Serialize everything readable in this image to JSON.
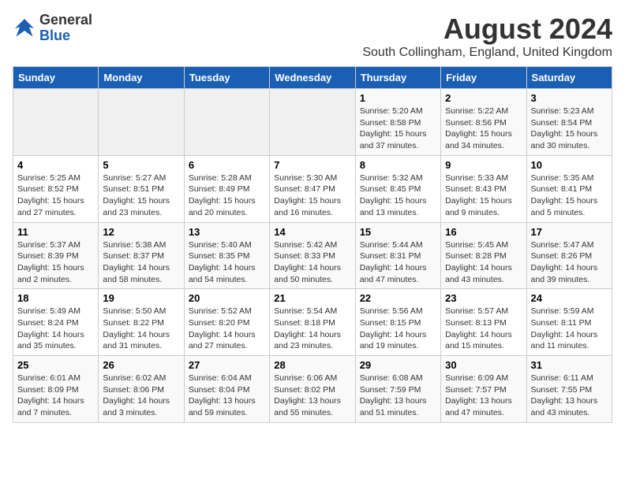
{
  "header": {
    "logo_line1": "General",
    "logo_line2": "Blue",
    "month_year": "August 2024",
    "location": "South Collingham, England, United Kingdom"
  },
  "weekdays": [
    "Sunday",
    "Monday",
    "Tuesday",
    "Wednesday",
    "Thursday",
    "Friday",
    "Saturday"
  ],
  "weeks": [
    [
      {
        "day": "",
        "info": ""
      },
      {
        "day": "",
        "info": ""
      },
      {
        "day": "",
        "info": ""
      },
      {
        "day": "",
        "info": ""
      },
      {
        "day": "1",
        "info": "Sunrise: 5:20 AM\nSunset: 8:58 PM\nDaylight: 15 hours\nand 37 minutes."
      },
      {
        "day": "2",
        "info": "Sunrise: 5:22 AM\nSunset: 8:56 PM\nDaylight: 15 hours\nand 34 minutes."
      },
      {
        "day": "3",
        "info": "Sunrise: 5:23 AM\nSunset: 8:54 PM\nDaylight: 15 hours\nand 30 minutes."
      }
    ],
    [
      {
        "day": "4",
        "info": "Sunrise: 5:25 AM\nSunset: 8:52 PM\nDaylight: 15 hours\nand 27 minutes."
      },
      {
        "day": "5",
        "info": "Sunrise: 5:27 AM\nSunset: 8:51 PM\nDaylight: 15 hours\nand 23 minutes."
      },
      {
        "day": "6",
        "info": "Sunrise: 5:28 AM\nSunset: 8:49 PM\nDaylight: 15 hours\nand 20 minutes."
      },
      {
        "day": "7",
        "info": "Sunrise: 5:30 AM\nSunset: 8:47 PM\nDaylight: 15 hours\nand 16 minutes."
      },
      {
        "day": "8",
        "info": "Sunrise: 5:32 AM\nSunset: 8:45 PM\nDaylight: 15 hours\nand 13 minutes."
      },
      {
        "day": "9",
        "info": "Sunrise: 5:33 AM\nSunset: 8:43 PM\nDaylight: 15 hours\nand 9 minutes."
      },
      {
        "day": "10",
        "info": "Sunrise: 5:35 AM\nSunset: 8:41 PM\nDaylight: 15 hours\nand 5 minutes."
      }
    ],
    [
      {
        "day": "11",
        "info": "Sunrise: 5:37 AM\nSunset: 8:39 PM\nDaylight: 15 hours\nand 2 minutes."
      },
      {
        "day": "12",
        "info": "Sunrise: 5:38 AM\nSunset: 8:37 PM\nDaylight: 14 hours\nand 58 minutes."
      },
      {
        "day": "13",
        "info": "Sunrise: 5:40 AM\nSunset: 8:35 PM\nDaylight: 14 hours\nand 54 minutes."
      },
      {
        "day": "14",
        "info": "Sunrise: 5:42 AM\nSunset: 8:33 PM\nDaylight: 14 hours\nand 50 minutes."
      },
      {
        "day": "15",
        "info": "Sunrise: 5:44 AM\nSunset: 8:31 PM\nDaylight: 14 hours\nand 47 minutes."
      },
      {
        "day": "16",
        "info": "Sunrise: 5:45 AM\nSunset: 8:28 PM\nDaylight: 14 hours\nand 43 minutes."
      },
      {
        "day": "17",
        "info": "Sunrise: 5:47 AM\nSunset: 8:26 PM\nDaylight: 14 hours\nand 39 minutes."
      }
    ],
    [
      {
        "day": "18",
        "info": "Sunrise: 5:49 AM\nSunset: 8:24 PM\nDaylight: 14 hours\nand 35 minutes."
      },
      {
        "day": "19",
        "info": "Sunrise: 5:50 AM\nSunset: 8:22 PM\nDaylight: 14 hours\nand 31 minutes."
      },
      {
        "day": "20",
        "info": "Sunrise: 5:52 AM\nSunset: 8:20 PM\nDaylight: 14 hours\nand 27 minutes."
      },
      {
        "day": "21",
        "info": "Sunrise: 5:54 AM\nSunset: 8:18 PM\nDaylight: 14 hours\nand 23 minutes."
      },
      {
        "day": "22",
        "info": "Sunrise: 5:56 AM\nSunset: 8:15 PM\nDaylight: 14 hours\nand 19 minutes."
      },
      {
        "day": "23",
        "info": "Sunrise: 5:57 AM\nSunset: 8:13 PM\nDaylight: 14 hours\nand 15 minutes."
      },
      {
        "day": "24",
        "info": "Sunrise: 5:59 AM\nSunset: 8:11 PM\nDaylight: 14 hours\nand 11 minutes."
      }
    ],
    [
      {
        "day": "25",
        "info": "Sunrise: 6:01 AM\nSunset: 8:09 PM\nDaylight: 14 hours\nand 7 minutes."
      },
      {
        "day": "26",
        "info": "Sunrise: 6:02 AM\nSunset: 8:06 PM\nDaylight: 14 hours\nand 3 minutes."
      },
      {
        "day": "27",
        "info": "Sunrise: 6:04 AM\nSunset: 8:04 PM\nDaylight: 13 hours\nand 59 minutes."
      },
      {
        "day": "28",
        "info": "Sunrise: 6:06 AM\nSunset: 8:02 PM\nDaylight: 13 hours\nand 55 minutes."
      },
      {
        "day": "29",
        "info": "Sunrise: 6:08 AM\nSunset: 7:59 PM\nDaylight: 13 hours\nand 51 minutes."
      },
      {
        "day": "30",
        "info": "Sunrise: 6:09 AM\nSunset: 7:57 PM\nDaylight: 13 hours\nand 47 minutes."
      },
      {
        "day": "31",
        "info": "Sunrise: 6:11 AM\nSunset: 7:55 PM\nDaylight: 13 hours\nand 43 minutes."
      }
    ]
  ]
}
